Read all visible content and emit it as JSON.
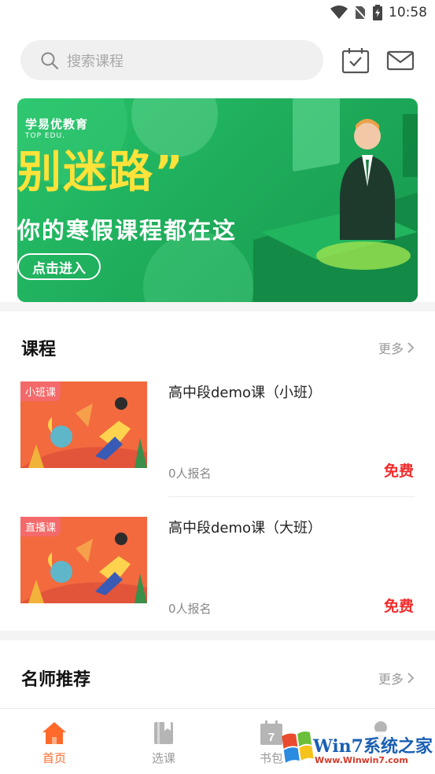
{
  "status_bar": {
    "time": "10:58"
  },
  "search": {
    "placeholder": "搜索课程"
  },
  "banner": {
    "brand": "学易优教育",
    "brand_en": "TOP EDU.",
    "headline": "别迷路”",
    "subline": "你的寒假课程都在这",
    "button": "点击进入"
  },
  "courses_section": {
    "title": "课程",
    "more": "更多",
    "items": [
      {
        "tag": "小班课",
        "title": "高中段demo课（小班）",
        "enrolled": "0人报名",
        "price": "免费"
      },
      {
        "tag": "直播课",
        "title": "高中段demo课（大班）",
        "enrolled": "0人报名",
        "price": "免费"
      }
    ]
  },
  "teachers_section": {
    "title": "名师推荐",
    "more": "更多"
  },
  "bottom_nav": {
    "items": [
      {
        "label": "首页",
        "icon": "home-icon",
        "active": true
      },
      {
        "label": "选课",
        "icon": "book-icon",
        "active": false
      },
      {
        "label": "书包",
        "icon": "calendar-icon",
        "badge": "7",
        "active": false
      },
      {
        "label": "我",
        "icon": "person-icon",
        "active": false
      }
    ]
  },
  "watermark": {
    "text": "Win7系统之家",
    "url": "Www.Winwin7.com"
  },
  "colors": {
    "accent": "#ff6a2b",
    "price": "#f12b2b",
    "banner_green": "#27c36a"
  }
}
